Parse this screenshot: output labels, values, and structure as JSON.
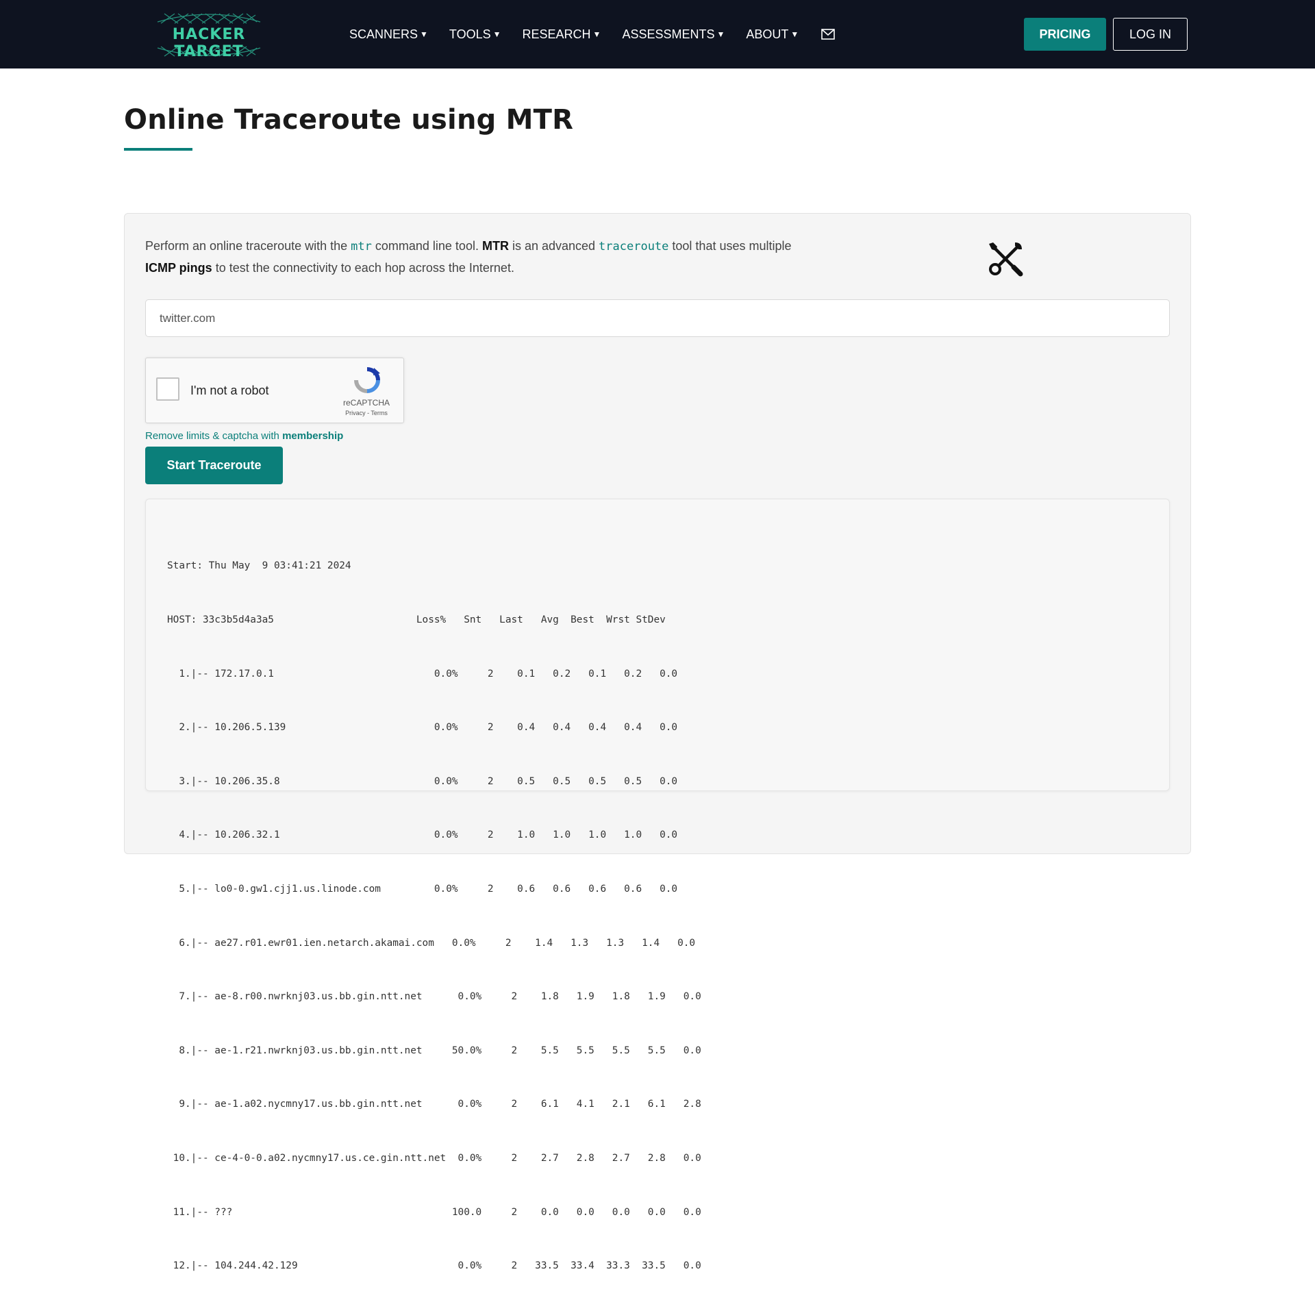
{
  "brand": {
    "name": "HACKER TARGET",
    "accent": "#0b7f7a",
    "logo_color": "#3fcfa6",
    "nav_bg": "#0e1320"
  },
  "nav": {
    "items": [
      {
        "label": "SCANNERS"
      },
      {
        "label": "TOOLS"
      },
      {
        "label": "RESEARCH"
      },
      {
        "label": "ASSESSMENTS"
      },
      {
        "label": "ABOUT"
      }
    ],
    "mail_icon": "envelope-icon",
    "pricing": "PRICING",
    "login": "LOG IN"
  },
  "page": {
    "title": "Online Traceroute using MTR"
  },
  "intro": {
    "p1": "Perform an online traceroute with the ",
    "code1": "mtr",
    "p2": " command line tool. ",
    "b1": "MTR",
    "p3": " is an advanced ",
    "code2": "traceroute",
    "p4": " tool that uses multiple ",
    "b2": "ICMP pings",
    "p5": " to test the connectivity to each hop across the Internet.",
    "icon": "tools-icon"
  },
  "form": {
    "target_value": "twitter.com",
    "captcha_label": "I'm not a robot",
    "captcha_brand": "reCAPTCHA",
    "captcha_links": "Privacy - Terms",
    "membership_prefix": "Remove limits & captcha with ",
    "membership_link": "membership",
    "start_button": "Start Traceroute"
  },
  "output": {
    "lines": [
      "Start: Thu May  9 03:41:21 2024",
      "HOST: 33c3b5d4a3a5                        Loss%   Snt   Last   Avg  Best  Wrst StDev",
      "  1.|-- 172.17.0.1                           0.0%     2    0.1   0.2   0.1   0.2   0.0",
      "  2.|-- 10.206.5.139                         0.0%     2    0.4   0.4   0.4   0.4   0.0",
      "  3.|-- 10.206.35.8                          0.0%     2    0.5   0.5   0.5   0.5   0.0",
      "  4.|-- 10.206.32.1                          0.0%     2    1.0   1.0   1.0   1.0   0.0",
      "  5.|-- lo0-0.gw1.cjj1.us.linode.com         0.0%     2    0.6   0.6   0.6   0.6   0.0",
      "  6.|-- ae27.r01.ewr01.ien.netarch.akamai.com   0.0%     2    1.4   1.3   1.3   1.4   0.0",
      "  7.|-- ae-8.r00.nwrknj03.us.bb.gin.ntt.net      0.0%     2    1.8   1.9   1.8   1.9   0.0",
      "  8.|-- ae-1.r21.nwrknj03.us.bb.gin.ntt.net     50.0%     2    5.5   5.5   5.5   5.5   0.0",
      "  9.|-- ae-1.a02.nycmny17.us.bb.gin.ntt.net      0.0%     2    6.1   4.1   2.1   6.1   2.8",
      " 10.|-- ce-4-0-0.a02.nycmny17.us.ce.gin.ntt.net  0.0%     2    2.7   2.8   2.7   2.8   0.0",
      " 11.|-- ???                                     100.0     2    0.0   0.0   0.0   0.0   0.0",
      " 12.|-- 104.244.42.129                           0.0%     2   33.5  33.4  33.3  33.5   0.0"
    ]
  }
}
